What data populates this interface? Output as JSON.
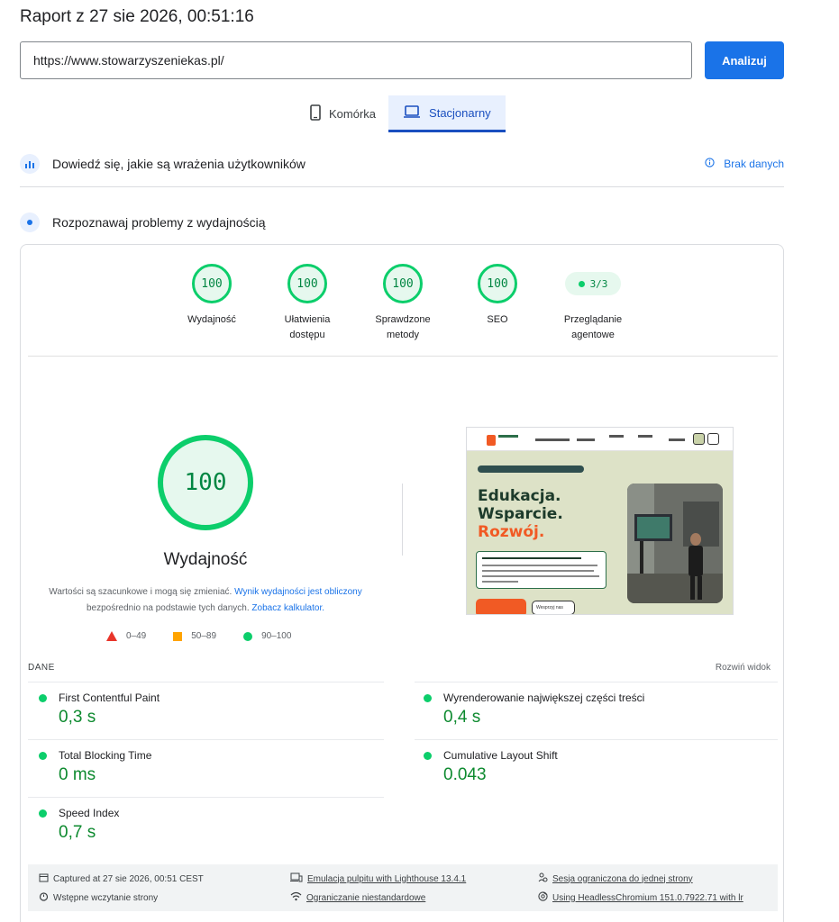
{
  "title": "Raport z 27 sie 2026, 00:51:16",
  "url_input": {
    "value": "https://www.stowarzyszeniekas.pl/"
  },
  "analyze_button": "Analizuj",
  "tabs": [
    {
      "label": "Komórka",
      "icon": "smartphone-icon",
      "active": false
    },
    {
      "label": "Stacjonarny",
      "icon": "laptop-icon",
      "active": true
    }
  ],
  "ux_section": {
    "title": "Dowiedź się, jakie są wrażenia użytkowników",
    "status": "Brak danych"
  },
  "perf_section": {
    "title": "Rozpoznawaj problemy z wydajnością"
  },
  "categories": [
    {
      "score": "100",
      "label": "Wydajność"
    },
    {
      "score": "100",
      "label": "Ułatwienia dostępu"
    },
    {
      "score": "100",
      "label": "Sprawdzone metody"
    },
    {
      "score": "100",
      "label": "SEO"
    },
    {
      "score": "3/3",
      "label": "Przeglądanie agentowe"
    }
  ],
  "performance": {
    "score": "100",
    "title": "Wydajność",
    "desc_part1": "Wartości są szacunkowe i mogą się zmieniać. ",
    "desc_link1": "Wynik wydajności jest obliczony",
    "desc_part2": " bezpośrednio na podstawie tych danych. ",
    "desc_link2": "Zobacz kalkulator."
  },
  "legend": [
    {
      "range": "0–49",
      "color": "#e8352a"
    },
    {
      "range": "50–89",
      "color": "#ffa400"
    },
    {
      "range": "90–100",
      "color": "#0cce6b"
    }
  ],
  "screenshot_text": {
    "heading1": "Edukacja.",
    "heading2": "Wsparcie.",
    "heading3": "Rozwój.",
    "button2": "Wesprzyj nas"
  },
  "metrics_header": {
    "label": "DANE",
    "expand": "Rozwiń widok"
  },
  "metrics": [
    {
      "name": "First Contentful Paint",
      "value": "0,3 s"
    },
    {
      "name": "Wyrenderowanie największej części treści",
      "value": "0,4 s"
    },
    {
      "name": "Total Blocking Time",
      "value": "0 ms"
    },
    {
      "name": "Cumulative Layout Shift",
      "value": "0.043"
    },
    {
      "name": "Speed Index",
      "value": "0,7 s"
    }
  ],
  "footer": {
    "captured": "Captured at 27 sie 2026, 00:51 CEST",
    "initial_load": "Wstępne wczytanie strony",
    "emulation": "Emulacja pulpitu with Lighthouse 13.4.1",
    "throttling": "Ograniczanie niestandardowe",
    "session": "Sesja ograniczona do jednej strony",
    "browser": "Using HeadlessChromium 151.0.7922.71 with lr"
  },
  "colors": {
    "accent": "#1a73e8",
    "pass": "#0cce6b",
    "pass_text": "#018642"
  }
}
